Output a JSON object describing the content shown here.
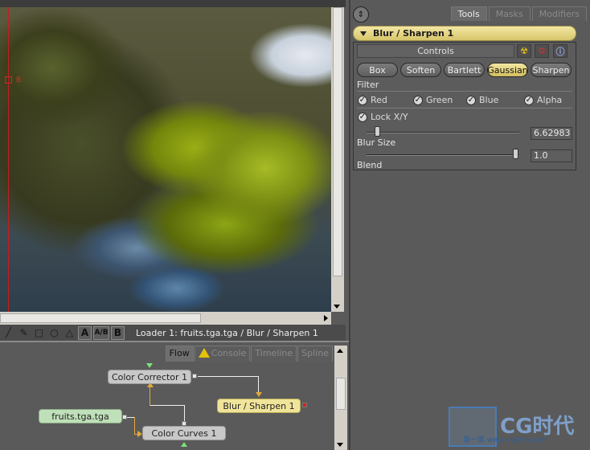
{
  "viewer": {
    "marker_label": "B",
    "status_text": "Loader 1: fruits.tga.tga / Blur / Sharpen 1",
    "toolbar_icons": [
      "line-icon",
      "wand-icon",
      "rectangle-icon",
      "ellipse-icon",
      "polygon-icon",
      "a-channel-icon",
      "ab-compare-icon",
      "b-channel-icon"
    ],
    "toolbar_glyphs": [
      "╱",
      "✎",
      "□",
      "○",
      "△",
      "A",
      "A/B",
      "B"
    ]
  },
  "flow": {
    "tabs": [
      {
        "label": "Flow",
        "active": true
      },
      {
        "label": "Console",
        "active": false
      },
      {
        "label": "Timeline",
        "active": false
      },
      {
        "label": "Spline",
        "active": false
      }
    ],
    "nodes": {
      "color_corrector": "Color Corrector 1",
      "blur_sharpen": "Blur / Sharpen 1",
      "loader": "fruits.tga.tga",
      "color_curves": "Color Curves 1"
    }
  },
  "panel": {
    "tabs": [
      {
        "label": "Tools",
        "active": true
      },
      {
        "label": "Masks",
        "active": false
      },
      {
        "label": "Modifiers",
        "active": false
      }
    ],
    "tool_title": "Blur / Sharpen 1",
    "controls_label": "Controls",
    "filter_buttons": [
      "Box",
      "Soften",
      "Bartlett",
      "Gaussian",
      "Sharpen"
    ],
    "selected_filter": "Gaussian",
    "filter_label": "Filter",
    "channels": [
      {
        "label": "Red",
        "checked": true
      },
      {
        "label": "Green",
        "checked": true
      },
      {
        "label": "Blue",
        "checked": true
      },
      {
        "label": "Alpha",
        "checked": true
      }
    ],
    "lock_xy": {
      "label": "Lock X/Y",
      "checked": true
    },
    "blur_size": {
      "label": "Blur Size",
      "value": "6.62983",
      "level": 0.05
    },
    "blend": {
      "label": "Blend",
      "value": "1.0",
      "level": 1.0
    },
    "icons": [
      "radioactive-icon",
      "gear-icon",
      "info-icon"
    ]
  },
  "watermark": {
    "logo": "CG时代",
    "sub": "第一家 www.cgtimo.com"
  },
  "colors": {
    "tool_header": "#e6d482",
    "selected_button": "#e6d482",
    "node_yellow": "#f0e49a",
    "node_green": "#bfe0b9",
    "node_gray": "#c8c8c8",
    "wire_orange": "#e2a93a",
    "viewer_red_line": "#c41e1e"
  }
}
